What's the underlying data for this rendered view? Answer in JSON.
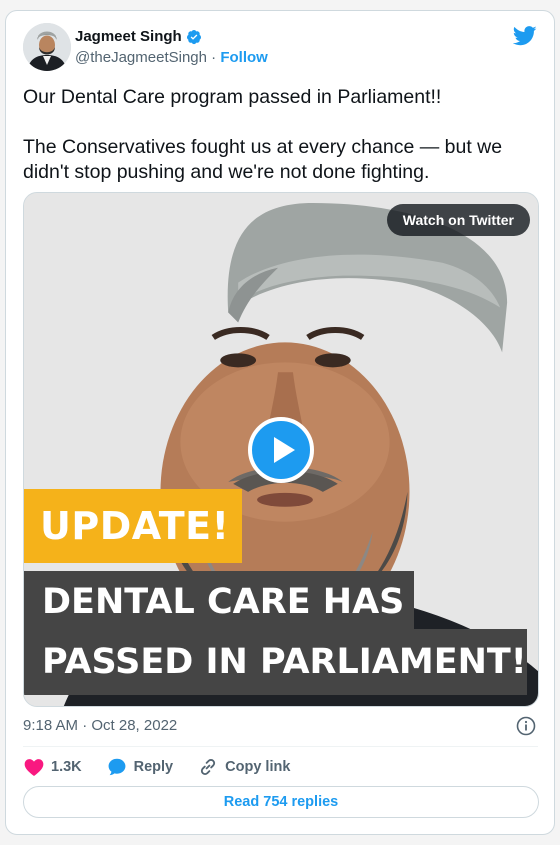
{
  "author": {
    "name": "Jagmeet Singh",
    "handle": "@theJagmeetSingh",
    "separator": "·",
    "follow_label": "Follow"
  },
  "tweet": {
    "paragraphs": [
      "Our Dental Care program passed in Parliament!!",
      "The Conservatives fought us at every chance — but we didn't stop pushing and we're not done fighting."
    ]
  },
  "media": {
    "watch_label": "Watch on Twitter",
    "overlay_update": "UPDATE!",
    "overlay_line1": "DENTAL CARE HAS",
    "overlay_line2": "PASSED IN PARLIAMENT!"
  },
  "meta": {
    "timestamp": "9:18 AM · Oct 28, 2022"
  },
  "actions": {
    "likes": "1.3K",
    "reply_label": "Reply",
    "copy_label": "Copy link"
  },
  "footer": {
    "read_replies": "Read 754 replies"
  },
  "colors": {
    "twitter_blue": "#1d9bf0",
    "like_pink": "#f91880",
    "update_orange": "#f5b21a",
    "banner_gray": "#454545"
  },
  "icons": [
    "twitter-bird-icon",
    "verified-badge-icon",
    "play-icon",
    "info-icon",
    "heart-icon",
    "reply-bubble-icon",
    "link-icon"
  ]
}
